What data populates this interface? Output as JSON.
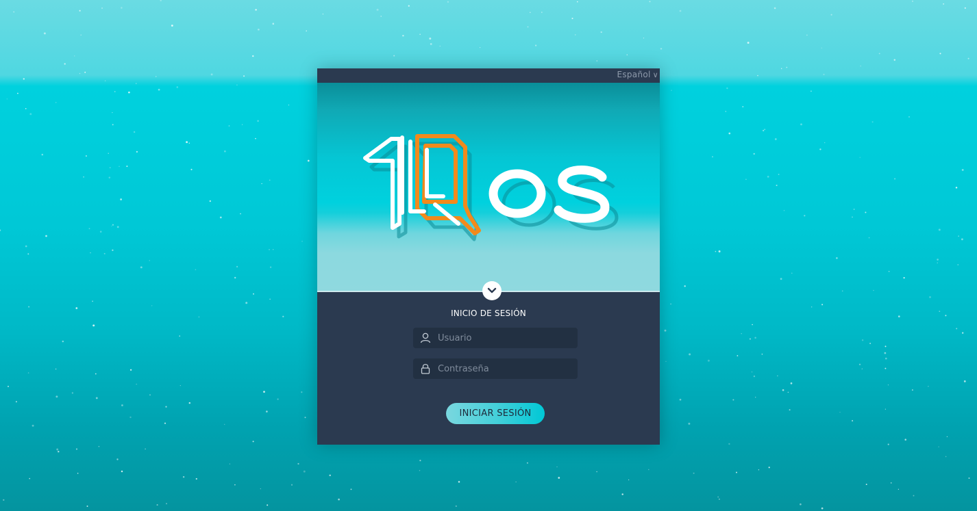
{
  "language": {
    "selected": "Español",
    "chevron_icon": "chevron-down-icon"
  },
  "brand": {
    "logo_text": "1QOS",
    "colors": {
      "orange": "#f28a1c",
      "white": "#ffffff",
      "shadow": "#0a8f9b"
    }
  },
  "login": {
    "title": "INICIO DE SESIÓN",
    "username_placeholder": "Usuario",
    "username_value": "",
    "password_placeholder": "Contraseña",
    "password_value": "",
    "submit_label": "INICIAR SESIÓN",
    "user_icon": "user-icon",
    "lock_icon": "lock-icon",
    "expand_icon": "chevron-down-circle-icon"
  },
  "colors": {
    "card_background": "#2b3a50",
    "input_background": "#223042",
    "accent": "#00c8d6"
  }
}
